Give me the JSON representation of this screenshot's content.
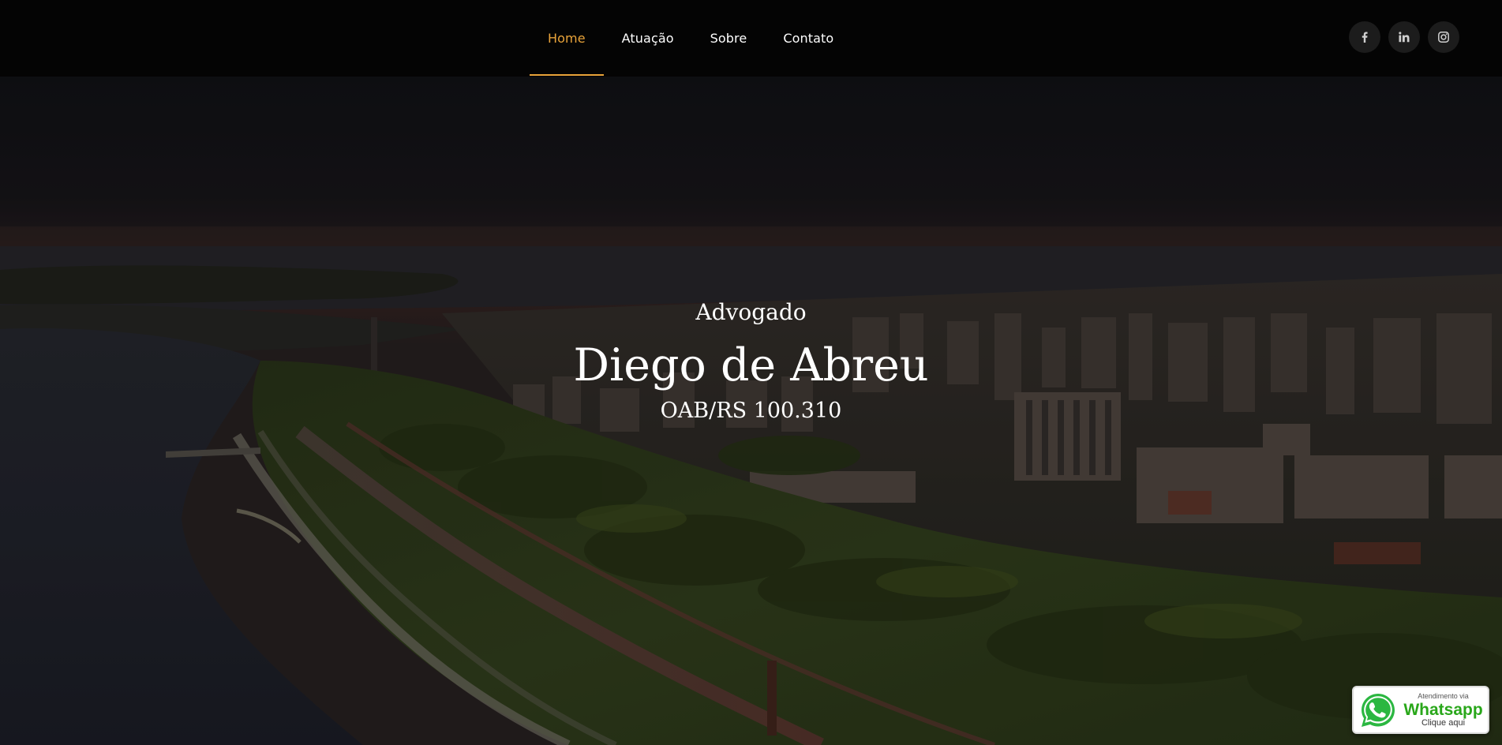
{
  "nav": {
    "items": [
      {
        "label": "Home",
        "active": true
      },
      {
        "label": "Atuação",
        "active": false
      },
      {
        "label": "Sobre",
        "active": false
      },
      {
        "label": "Contato",
        "active": false
      }
    ],
    "active_color": "#e8a33a"
  },
  "social": [
    {
      "icon": "facebook-icon"
    },
    {
      "icon": "linkedin-icon"
    },
    {
      "icon": "instagram-icon"
    }
  ],
  "hero": {
    "kicker": "Advogado",
    "title": "Diego de Abreu",
    "subtitle": "OAB/RS 100.310"
  },
  "whatsapp": {
    "small": "Atendimento via",
    "brand": "Whatsapp",
    "cta": "Clique aqui",
    "color": "#29a71a"
  }
}
